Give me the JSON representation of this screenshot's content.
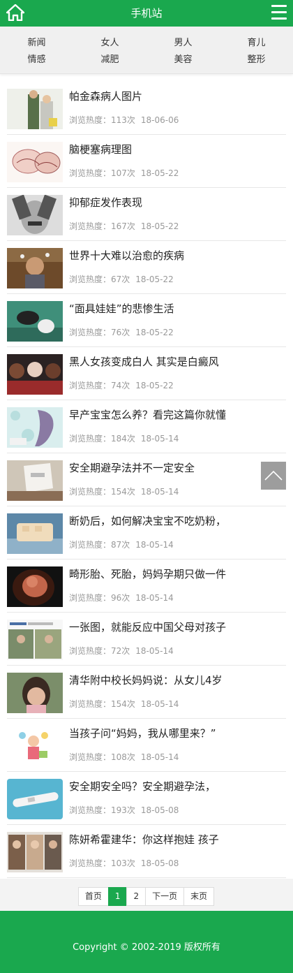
{
  "header": {
    "title": "手机站",
    "home_icon": "home-icon",
    "menu_icon": "menu-icon"
  },
  "categories": [
    [
      "新闻",
      "女人",
      "男人",
      "育儿"
    ],
    [
      "情感",
      "减肥",
      "美容",
      "整形"
    ]
  ],
  "articles": [
    {
      "title": "帕金森病人图片",
      "heat_label": "浏览热度：113次",
      "date": "18-06-06"
    },
    {
      "title": "脑梗塞病理图",
      "heat_label": "浏览热度：107次",
      "date": "18-05-22"
    },
    {
      "title": "抑郁症发作表现",
      "heat_label": "浏览热度：167次",
      "date": "18-05-22"
    },
    {
      "title": "世界十大难以治愈的疾病",
      "heat_label": "浏览热度：67次",
      "date": "18-05-22"
    },
    {
      "title": "“面具娃娃”的悲惨生活",
      "heat_label": "浏览热度：76次",
      "date": "18-05-22"
    },
    {
      "title": "黑人女孩变成白人 其实是白癜风",
      "heat_label": "浏览热度：74次",
      "date": "18-05-22"
    },
    {
      "title": "早产宝宝怎么养？看完这篇你就懂",
      "heat_label": "浏览热度：184次",
      "date": "18-05-14"
    },
    {
      "title": "安全期避孕法并不一定安全",
      "heat_label": "浏览热度：154次",
      "date": "18-05-14"
    },
    {
      "title": "断奶后，如何解决宝宝不吃奶粉，",
      "heat_label": "浏览热度：87次",
      "date": "18-05-14"
    },
    {
      "title": "畸形胎、死胎，妈妈孕期只做一件",
      "heat_label": "浏览热度：96次",
      "date": "18-05-14"
    },
    {
      "title": "一张图，就能反应中国父母对孩子",
      "heat_label": "浏览热度：72次",
      "date": "18-05-14"
    },
    {
      "title": "清华附中校长妈妈说：从女儿4岁",
      "heat_label": "浏览热度：154次",
      "date": "18-05-14"
    },
    {
      "title": "当孩子问“妈妈，我从哪里来？”",
      "heat_label": "浏览热度：108次",
      "date": "18-05-14"
    },
    {
      "title": "安全期安全吗？安全期避孕法，",
      "heat_label": "浏览热度：193次",
      "date": "18-05-08"
    },
    {
      "title": "陈妍希霍建华：你这样抱娃 孩子",
      "heat_label": "浏览热度：103次",
      "date": "18-05-08"
    }
  ],
  "pagination": [
    "首页",
    "1",
    "2",
    "下一页",
    "末页"
  ],
  "pagination_active": "1",
  "back_to_top_icon": "chevron-up-icon",
  "footer": {
    "copyright": "Copyright © 2002-2019 版权所有"
  },
  "colors": {
    "brand": "#1aa84e",
    "nav_bg": "#f0f0f0",
    "meta_text": "#999999"
  }
}
